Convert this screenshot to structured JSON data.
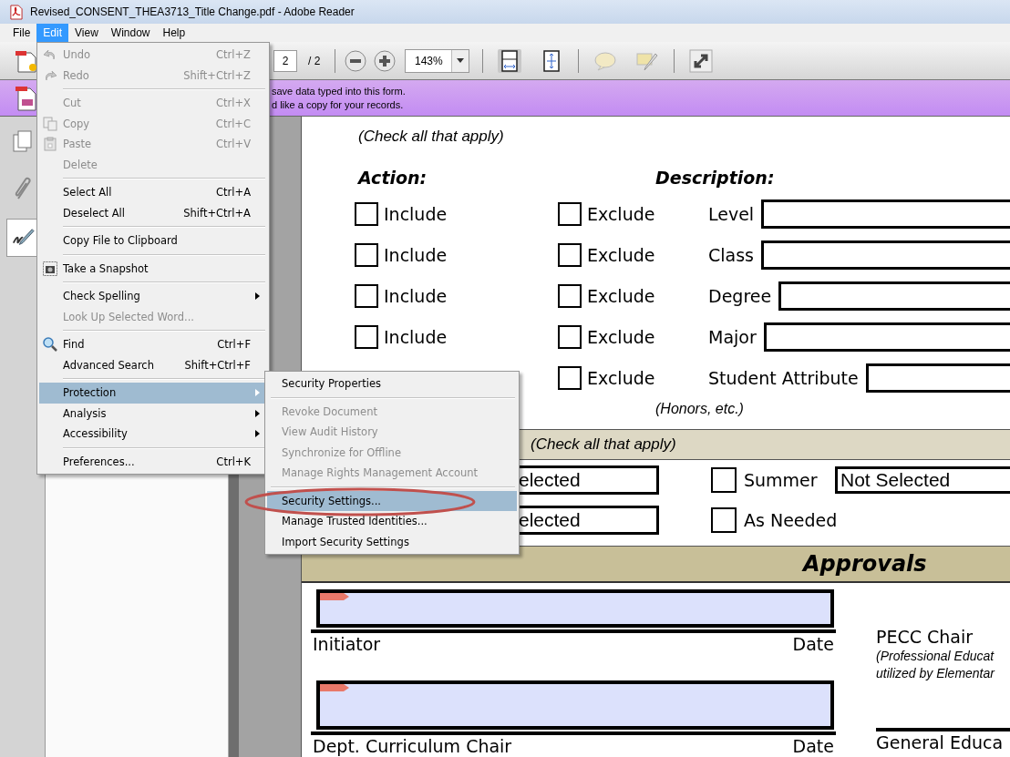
{
  "window": {
    "title": "Revised_CONSENT_THEA3713_Title Change.pdf - Adobe Reader"
  },
  "menubar": [
    {
      "label": "File",
      "selected": false
    },
    {
      "label": "Edit",
      "selected": true
    },
    {
      "label": "View",
      "selected": false
    },
    {
      "label": "Window",
      "selected": false
    },
    {
      "label": "Help",
      "selected": false
    }
  ],
  "toolbar": {
    "page_number": "2",
    "page_total": "/ 2",
    "zoom": "143%"
  },
  "notice": {
    "lines": [
      "save data typed into this form.",
      "d like a copy for your records."
    ]
  },
  "nav_tabs": [
    {
      "selected": false
    },
    {
      "selected": false
    },
    {
      "selected": true
    }
  ],
  "edit_menu": {
    "groups": [
      [
        {
          "label": "Undo",
          "shortcut": "Ctrl+Z",
          "disabled": true,
          "submenu": false,
          "selected": false
        },
        {
          "label": "Redo",
          "shortcut": "Shift+Ctrl+Z",
          "disabled": true,
          "submenu": false,
          "selected": false
        }
      ],
      [
        {
          "label": "Cut",
          "shortcut": "Ctrl+X",
          "disabled": true,
          "submenu": false,
          "selected": false
        },
        {
          "label": "Copy",
          "shortcut": "Ctrl+C",
          "disabled": true,
          "submenu": false,
          "selected": false
        },
        {
          "label": "Paste",
          "shortcut": "Ctrl+V",
          "disabled": true,
          "submenu": false,
          "selected": false
        },
        {
          "label": "Delete",
          "disabled": true,
          "submenu": false,
          "selected": false
        }
      ],
      [
        {
          "label": "Select All",
          "shortcut": "Ctrl+A",
          "disabled": false,
          "submenu": false,
          "selected": false
        },
        {
          "label": "Deselect All",
          "shortcut": "Shift+Ctrl+A",
          "disabled": false,
          "submenu": false,
          "selected": false
        }
      ],
      [
        {
          "label": "Copy File to Clipboard",
          "disabled": false,
          "submenu": false,
          "selected": false
        }
      ],
      [
        {
          "label": "Take a Snapshot",
          "disabled": false,
          "submenu": false,
          "selected": false
        }
      ],
      [
        {
          "label": "Check Spelling",
          "disabled": false,
          "submenu": true,
          "selected": false
        },
        {
          "label": "Look Up Selected Word...",
          "disabled": true,
          "submenu": false,
          "selected": false
        }
      ],
      [
        {
          "label": "Find",
          "shortcut": "Ctrl+F",
          "disabled": false,
          "submenu": false,
          "selected": false
        },
        {
          "label": "Advanced Search",
          "shortcut": "Shift+Ctrl+F",
          "disabled": false,
          "submenu": false,
          "selected": false
        }
      ],
      [
        {
          "label": "Protection",
          "disabled": false,
          "submenu": true,
          "selected": true
        },
        {
          "label": "Analysis",
          "disabled": false,
          "submenu": true,
          "selected": false
        },
        {
          "label": "Accessibility",
          "disabled": false,
          "submenu": true,
          "selected": false
        }
      ],
      [
        {
          "label": "Preferences...",
          "shortcut": "Ctrl+K",
          "disabled": false,
          "submenu": false,
          "selected": false
        }
      ]
    ]
  },
  "protection_submenu": {
    "groups": [
      [
        {
          "label": "Security Properties",
          "disabled": false,
          "selected": false,
          "circled": false
        }
      ],
      [
        {
          "label": "Revoke Document",
          "disabled": true,
          "selected": false,
          "circled": false
        },
        {
          "label": "View Audit History",
          "disabled": true,
          "selected": false,
          "circled": false
        },
        {
          "label": "Synchronize for Offline",
          "disabled": true,
          "selected": false,
          "circled": false
        },
        {
          "label": "Manage Rights Management Account",
          "disabled": true,
          "selected": false,
          "circled": false
        }
      ],
      [
        {
          "label": "Security Settings...",
          "disabled": false,
          "selected": true,
          "circled": true
        },
        {
          "label": "Manage Trusted Identities...",
          "disabled": false,
          "selected": false,
          "circled": false
        },
        {
          "label": "Import Security Settings",
          "disabled": false,
          "selected": false,
          "circled": false
        }
      ]
    ]
  },
  "form": {
    "intro": "(Check all that apply)",
    "action_heading": "Action:",
    "description_heading": "Description:",
    "rows": [
      {
        "include": {
          "label": "Include",
          "checked": false
        },
        "exclude": {
          "label": "Exclude",
          "checked": false
        },
        "description": "Level"
      },
      {
        "include": {
          "label": "Include",
          "checked": false
        },
        "exclude": {
          "label": "Exclude",
          "checked": false
        },
        "description": "Class"
      },
      {
        "include": {
          "label": "Include",
          "checked": false
        },
        "exclude": {
          "label": "Exclude",
          "checked": false
        },
        "description": "Degree"
      },
      {
        "include": {
          "label": "Include",
          "checked": false
        },
        "exclude": {
          "label": "Exclude",
          "checked": false
        },
        "description": "Major"
      },
      {
        "exclude": {
          "label": "Exclude",
          "checked": false
        },
        "description": "Student Attribute"
      }
    ],
    "note": "(Honors, etc.)",
    "term_heading": "(Check all that apply)",
    "terms": [
      {
        "field_value": "elected",
        "checkbox": {
          "label": "Summer",
          "checked": false
        },
        "value": "Not Selected"
      },
      {
        "field_value": "elected",
        "checkbox": {
          "label": "As Needed",
          "checked": false
        }
      }
    ],
    "approvals_heading": "Approvals",
    "signatures": [
      {
        "label": "Initiator",
        "date": "Date",
        "right_label": "PECC Chair",
        "right_notes": [
          "(Professional Educat",
          "utilized by Elementar"
        ]
      },
      {
        "label": "Dept. Curriculum Chair",
        "date": "Date",
        "right_label": "General Educa"
      }
    ]
  }
}
